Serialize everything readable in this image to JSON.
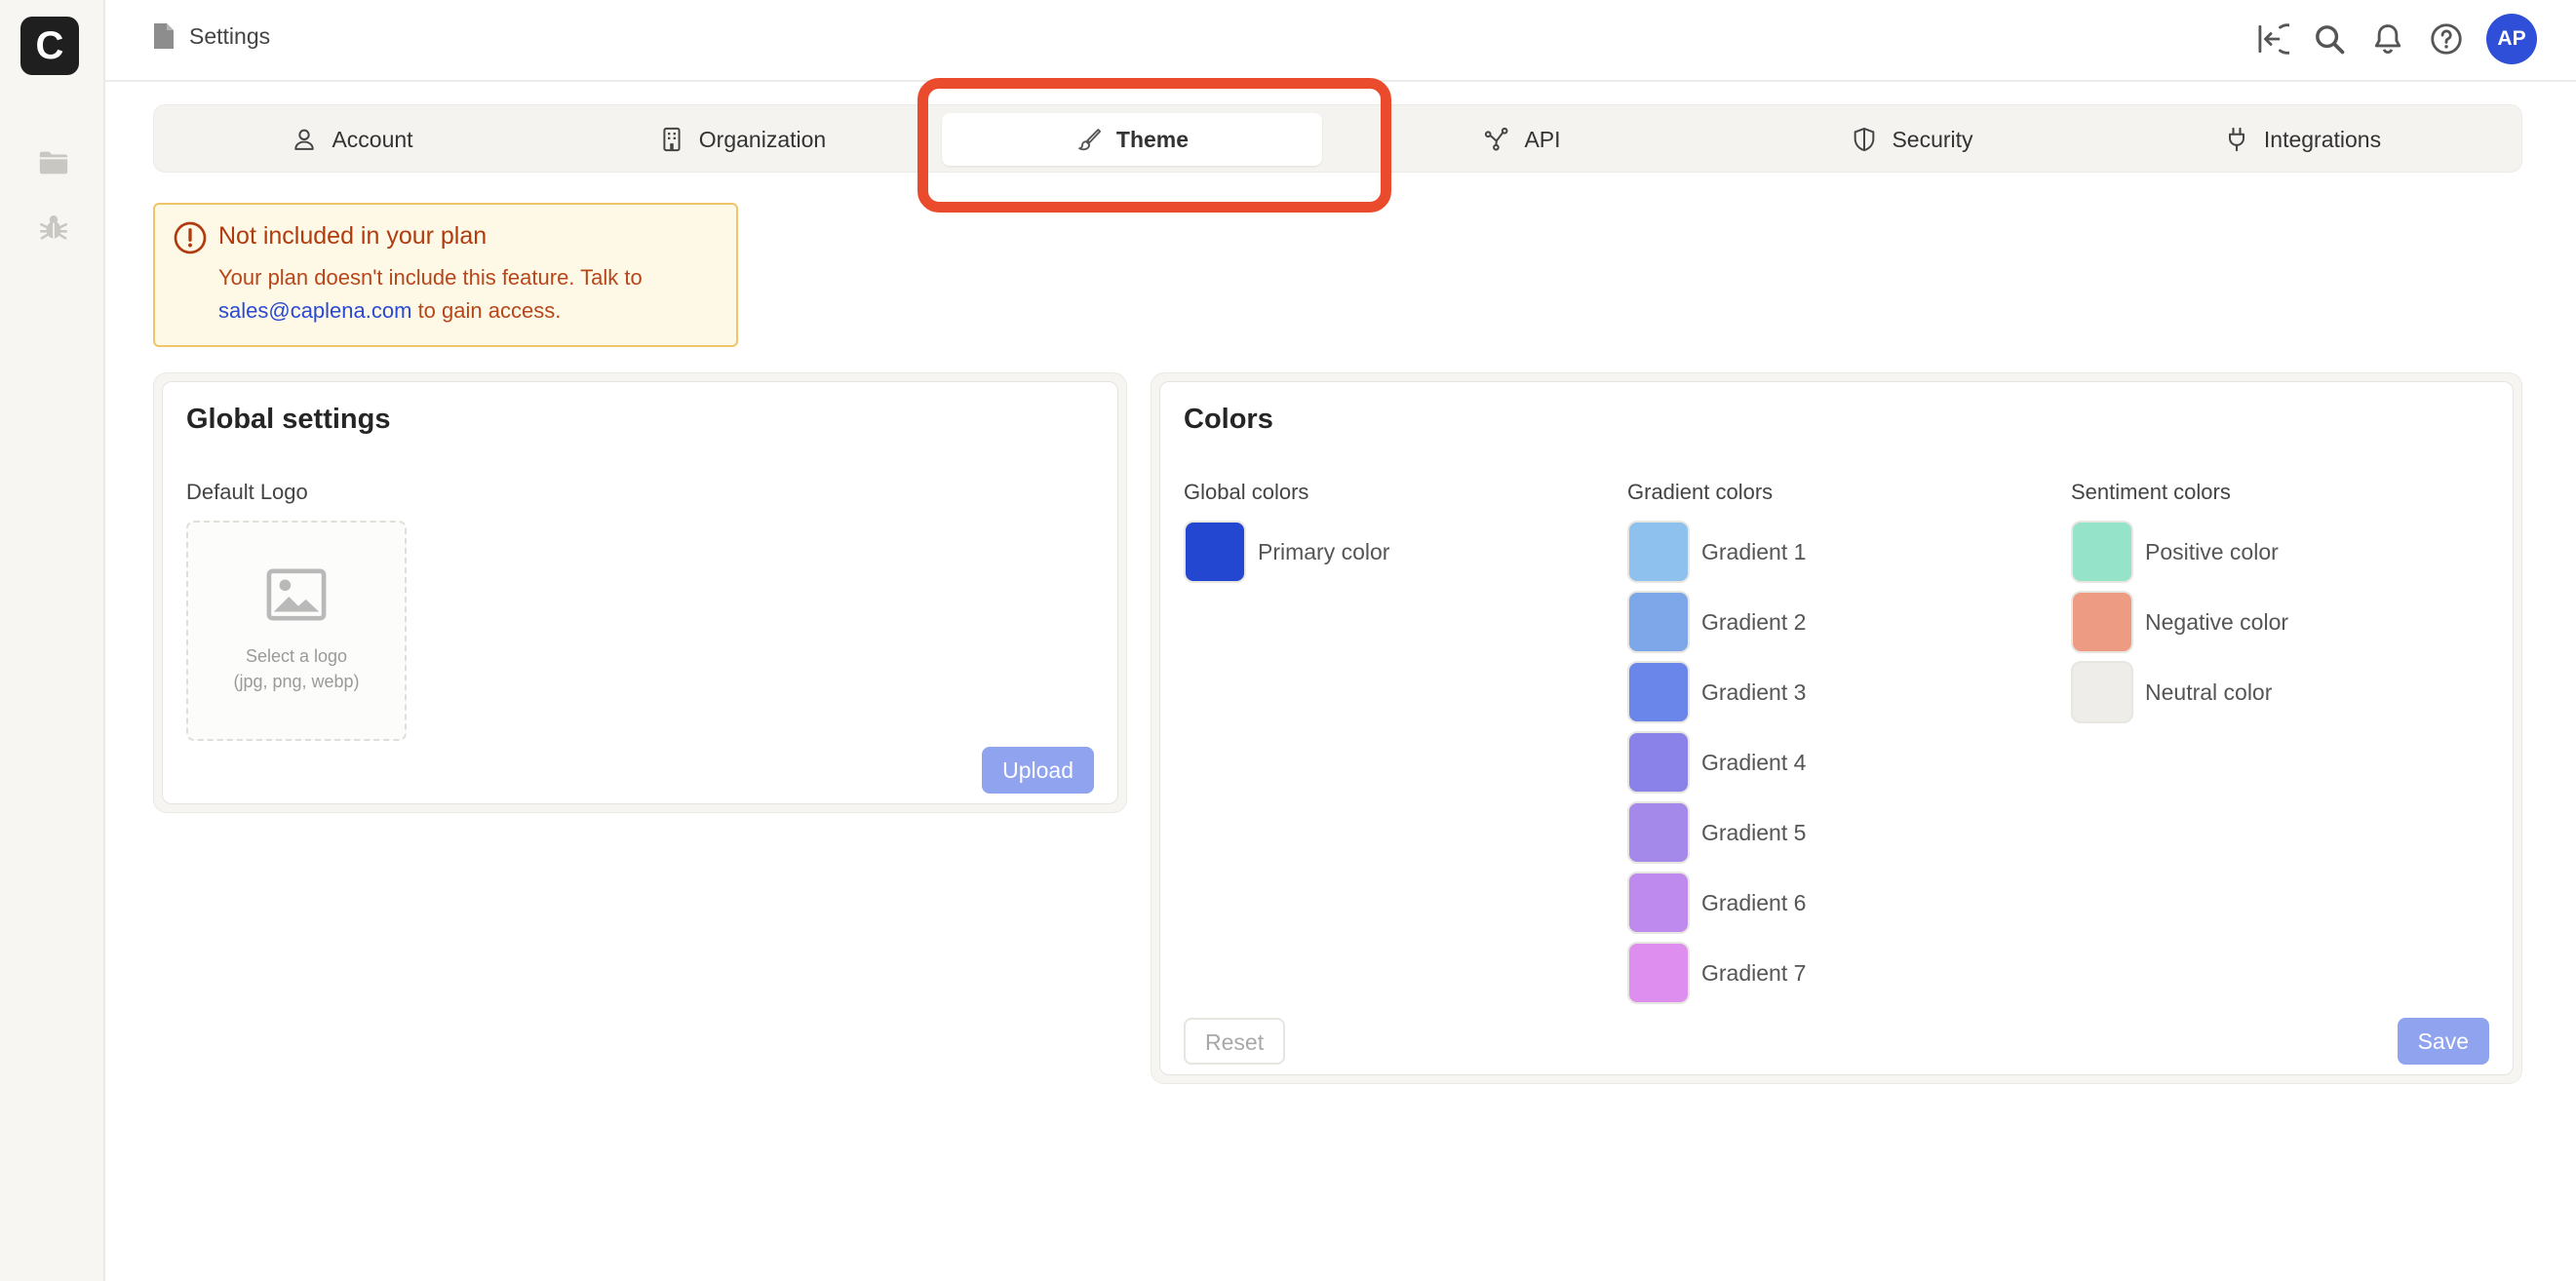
{
  "rail": {
    "logo_letter": "C"
  },
  "header": {
    "breadcrumb": "Settings",
    "avatar_initials": "AP"
  },
  "tabs": [
    {
      "label": "Account",
      "icon": "user-icon",
      "active": false
    },
    {
      "label": "Organization",
      "icon": "building-icon",
      "active": false
    },
    {
      "label": "Theme",
      "icon": "brush-icon",
      "active": true
    },
    {
      "label": "API",
      "icon": "network-icon",
      "active": false
    },
    {
      "label": "Security",
      "icon": "shield-icon",
      "active": false
    },
    {
      "label": "Integrations",
      "icon": "plug-icon",
      "active": false
    }
  ],
  "alert": {
    "title": "Not included in your plan",
    "body_prefix": "Your plan doesn't include this feature. Talk to",
    "link": "sales@caplena.com",
    "body_suffix": "to gain access."
  },
  "global_settings": {
    "title": "Global settings",
    "logo_label": "Default Logo",
    "drop_line1": "Select a logo",
    "drop_line2": "(jpg, png, webp)",
    "upload_button": "Upload"
  },
  "colors": {
    "title": "Colors",
    "global": {
      "heading": "Global colors",
      "items": [
        {
          "label": "Primary color",
          "color": "#2447d1"
        }
      ]
    },
    "gradient": {
      "heading": "Gradient colors",
      "items": [
        {
          "label": "Gradient 1",
          "color": "#8ec1ee"
        },
        {
          "label": "Gradient 2",
          "color": "#7da7e8"
        },
        {
          "label": "Gradient 3",
          "color": "#6b86ea"
        },
        {
          "label": "Gradient 4",
          "color": "#8a82e8"
        },
        {
          "label": "Gradient 5",
          "color": "#a488ea"
        },
        {
          "label": "Gradient 6",
          "color": "#be8aee"
        },
        {
          "label": "Gradient 7",
          "color": "#de8eef"
        }
      ]
    },
    "sentiment": {
      "heading": "Sentiment colors",
      "items": [
        {
          "label": "Positive color",
          "color": "#95e3c8"
        },
        {
          "label": "Negative color",
          "color": "#ee9b83"
        },
        {
          "label": "Neutral color",
          "color": "#efede9"
        }
      ]
    },
    "reset_button": "Reset",
    "save_button": "Save"
  },
  "accent": {
    "brand": "#2f4fd8",
    "highlight": "#ea4b2c"
  }
}
